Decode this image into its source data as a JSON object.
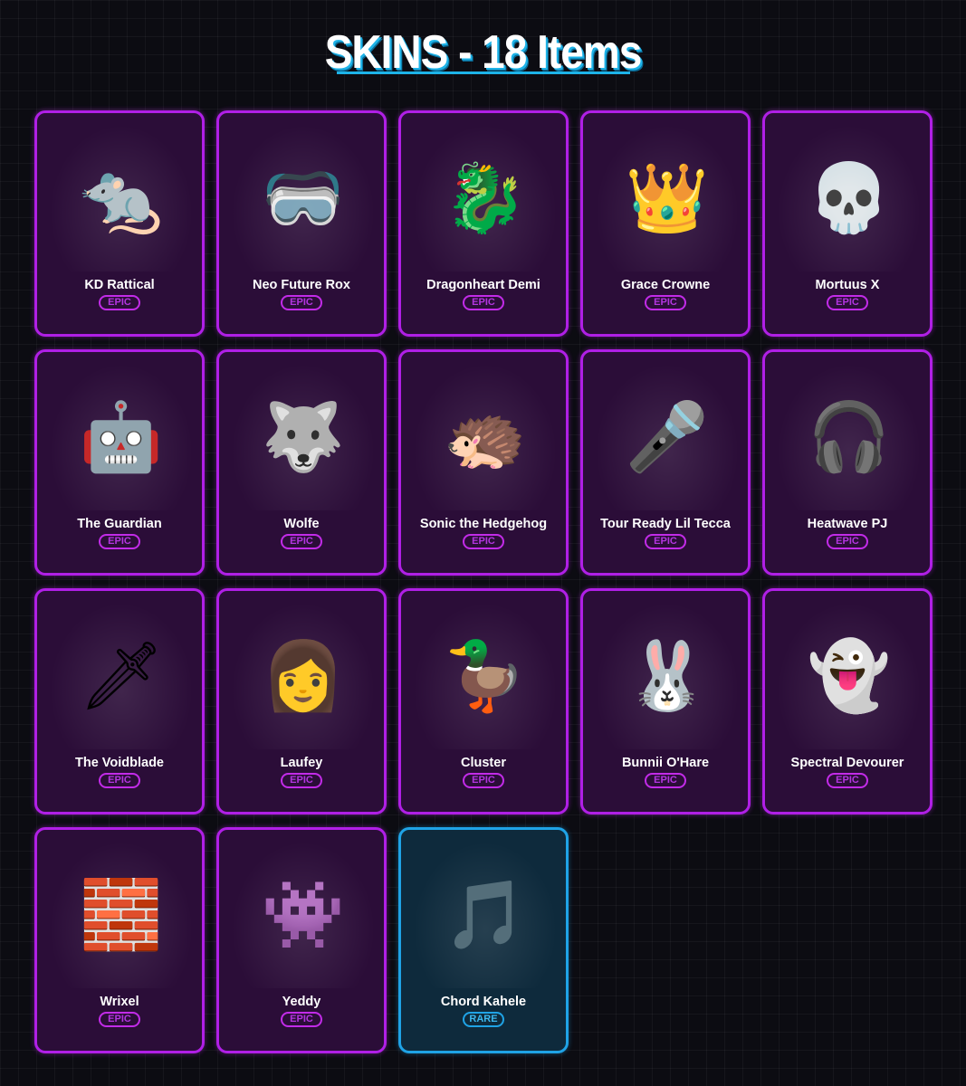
{
  "header": {
    "title": "SKINS - 18 Items"
  },
  "colors": {
    "epic": "#b01fe6",
    "rare": "#1fa3e6",
    "accent": "#1db3e8"
  },
  "items": [
    {
      "name": "KD Rattical",
      "rarity": "EPIC",
      "icon": "rat-icon",
      "glyph": "🐀"
    },
    {
      "name": "Neo Future Rox",
      "rarity": "EPIC",
      "icon": "goggles-icon",
      "glyph": "🥽"
    },
    {
      "name": "Dragonheart Demi",
      "rarity": "EPIC",
      "icon": "dragon-icon",
      "glyph": "🐉"
    },
    {
      "name": "Grace Crowne",
      "rarity": "EPIC",
      "icon": "crown-icon",
      "glyph": "👑"
    },
    {
      "name": "Mortuus X",
      "rarity": "EPIC",
      "icon": "skull-icon",
      "glyph": "💀"
    },
    {
      "name": "The Guardian",
      "rarity": "EPIC",
      "icon": "robot-icon",
      "glyph": "🤖"
    },
    {
      "name": "Wolfe",
      "rarity": "EPIC",
      "icon": "wolf-icon",
      "glyph": "🐺"
    },
    {
      "name": "Sonic the Hedgehog",
      "rarity": "EPIC",
      "icon": "hedgehog-icon",
      "glyph": "🦔"
    },
    {
      "name": "Tour Ready Lil Tecca",
      "rarity": "EPIC",
      "icon": "microphone-icon",
      "glyph": "🎤"
    },
    {
      "name": "Heatwave PJ",
      "rarity": "EPIC",
      "icon": "headphones-icon",
      "glyph": "🎧"
    },
    {
      "name": "The Voidblade",
      "rarity": "EPIC",
      "icon": "sword-icon",
      "glyph": "🗡"
    },
    {
      "name": "Laufey",
      "rarity": "EPIC",
      "icon": "person-icon",
      "glyph": "👩"
    },
    {
      "name": "Cluster",
      "rarity": "EPIC",
      "icon": "duck-icon",
      "glyph": "🦆"
    },
    {
      "name": "Bunnii O'Hare",
      "rarity": "EPIC",
      "icon": "rabbit-icon",
      "glyph": "🐰"
    },
    {
      "name": "Spectral Devourer",
      "rarity": "EPIC",
      "icon": "ghost-icon",
      "glyph": "👻"
    },
    {
      "name": "Wrixel",
      "rarity": "EPIC",
      "icon": "block-head-icon",
      "glyph": "🧱"
    },
    {
      "name": "Yeddy",
      "rarity": "EPIC",
      "icon": "pink-monster-icon",
      "glyph": "👾"
    },
    {
      "name": "Chord Kahele",
      "rarity": "RARE",
      "icon": "music-icon",
      "glyph": "🎵"
    }
  ]
}
